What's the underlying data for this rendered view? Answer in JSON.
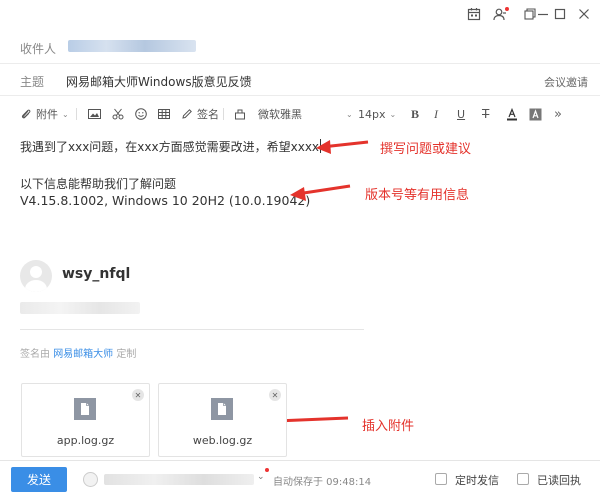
{
  "titlebar": {
    "icons": [
      "calendar-icon",
      "contacts-icon",
      "restore-icon",
      "minimize-icon",
      "maximize-icon",
      "close-icon"
    ]
  },
  "recipient": {
    "label": "收件人"
  },
  "subject": {
    "label": "主题",
    "value": "网易邮箱大师Windows版意见反馈",
    "meeting_invite": "会议邀请"
  },
  "toolbar": {
    "attachment_label": "附件",
    "signature_label": "签名",
    "font_family": "微软雅黑",
    "font_size": "14px"
  },
  "body": {
    "line1": "我遇到了xxx问题，在xxx方面感觉需要改进，希望xxxx",
    "line2": "以下信息能帮助我们了解问题",
    "line3": "V4.15.8.1002, Windows 10 20H2 (10.0.19042)"
  },
  "annotations": {
    "write_issue": "撰写问题或建议",
    "version_info": "版本号等有用信息",
    "insert_attachment": "插入附件"
  },
  "signature": {
    "name": "wsy_nfql",
    "by_prefix": "签名由",
    "by_app": "网易邮箱大师",
    "by_suffix": "定制"
  },
  "attachments": [
    {
      "name": "app.log.gz"
    },
    {
      "name": "web.log.gz"
    }
  ],
  "bottom": {
    "send_label": "发送",
    "autosave": "自动保存于 09:48:14",
    "scheduled_label": "定时发信",
    "read_receipt_label": "已读回执"
  },
  "colors": {
    "accent": "#3a8ee6",
    "annotation_red": "#e4332c"
  }
}
